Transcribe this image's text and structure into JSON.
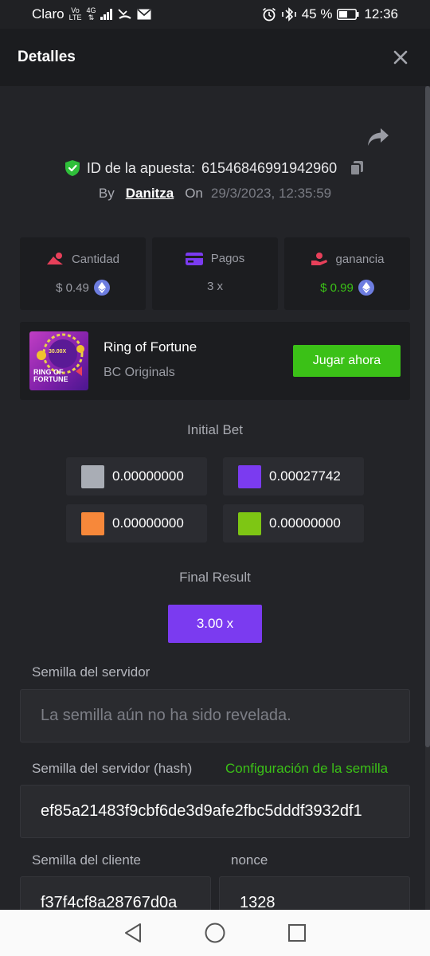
{
  "status_bar": {
    "carrier": "Claro",
    "volte_top": "Vo",
    "volte_bottom": "LTE",
    "net_top": "4G",
    "net_bottom": "⇅",
    "battery_percent": "45 %",
    "time": "12:36"
  },
  "header": {
    "title": "Detalles"
  },
  "bet": {
    "id_label": "ID de la apuesta:",
    "id_value": "61546846991942960",
    "by_label": "By",
    "user": "Danitza",
    "on_label": "On",
    "date": "29/3/2023, 12:35:59"
  },
  "stats": {
    "amount": {
      "label": "Cantidad",
      "value": "$ 0.49"
    },
    "payout": {
      "label": "Pagos",
      "value": "3 x"
    },
    "profit": {
      "label": "ganancia",
      "value": "$ 0.99"
    }
  },
  "game": {
    "name": "Ring of Fortune",
    "provider": "BC Originals",
    "thumb_multiplier": "30.00X",
    "thumb_title_1": "RING OF",
    "thumb_title_2": "FORTUNE",
    "play_label": "Jugar ahora"
  },
  "initial_bet": {
    "title": "Initial Bet",
    "chips": [
      {
        "color": "#a9adb5",
        "value": "0.00000000"
      },
      {
        "color": "#7b3bf0",
        "value": "0.00027742"
      },
      {
        "color": "#f7883a",
        "value": "0.00000000"
      },
      {
        "color": "#7ec614",
        "value": "0.00000000"
      }
    ]
  },
  "final_result": {
    "title": "Final Result",
    "value": "3.00 x"
  },
  "seeds": {
    "server_label": "Semilla del servidor",
    "server_value": "La semilla aún no ha sido revelada.",
    "server_hash_label": "Semilla del servidor (hash)",
    "seed_config_link": "Configuración de la semilla",
    "server_hash_value": "ef85a21483f9cbf6de3d9afe2fbc5dddf3932df1",
    "client_label": "Semilla del cliente",
    "client_value": "f37f4cf8a28767d0a",
    "nonce_label": "nonce",
    "nonce_value": "1328"
  },
  "colors": {
    "accent_green": "#3bc117",
    "accent_purple": "#7b3bf0",
    "shield_green": "#2fbf3a",
    "amount_icon_red": "#e8405a",
    "profit_icon_red": "#e8405a",
    "eth_blue": "#6d7de0"
  }
}
